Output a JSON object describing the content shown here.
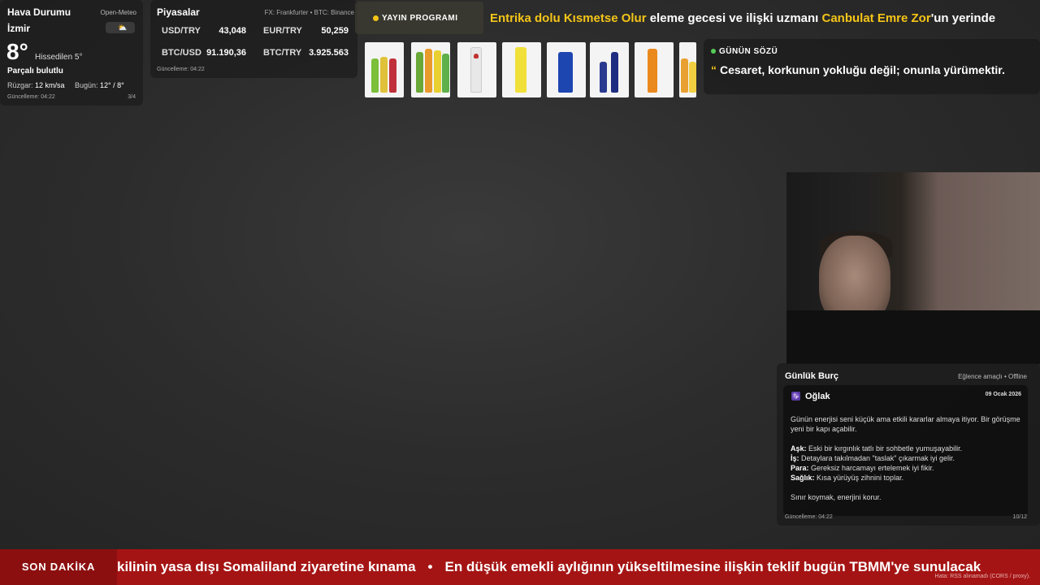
{
  "weather": {
    "title": "Hava Durumu",
    "source": "Open-Meteo",
    "city": "İzmir",
    "icon": "cloud-sun-icon",
    "temperature": "8°",
    "feels_like": "Hissedilen 5°",
    "condition": "Parçalı bulutlu",
    "wind_label": "Rüzgar:",
    "wind_value": "12 km/sa",
    "today_label": "Bugün:",
    "today_value": "12° / 8°",
    "updated": "Güncelleme: 04:22",
    "page": "3/4"
  },
  "markets": {
    "title": "Piyasalar",
    "source": "FX: Frankfurter • BTC: Binance",
    "rows": [
      {
        "label": "USD/TRY",
        "value": "43,048"
      },
      {
        "label": "EUR/TRY",
        "value": "50,259"
      },
      {
        "label": "BTC/USD",
        "value": "91.190,36"
      },
      {
        "label": "BTC/TRY",
        "value": "3.925.563"
      }
    ],
    "updated": "Güncelleme: 04:22"
  },
  "program": {
    "label": "YAYIN PROGRAMI",
    "parts": [
      {
        "text": "Entrika dolu Kısmetse Olur",
        "highlight": true
      },
      {
        "text": " eleme gecesi ve ilişki uzmanı ",
        "highlight": false
      },
      {
        "text": "Canbulat Emre Zor",
        "highlight": true
      },
      {
        "text": "'un yerinde",
        "highlight": false
      }
    ]
  },
  "products": {
    "items": [
      "product-bottle-1",
      "product-bottle-2",
      "product-bottle-3",
      "product-bottle-4",
      "product-bottle-5",
      "product-bottle-6",
      "product-bottle-7",
      "product-bottle-8"
    ]
  },
  "quote": {
    "label": "GÜNÜN SÖZÜ",
    "open_mark": "“",
    "text": "Cesaret, korkunun yokluğu değil; onunla yürümektir."
  },
  "horoscope": {
    "title": "Günlük Burç",
    "mode": "Eğlence amaçlı • Offline",
    "sign_icon": "♑",
    "sign": "Oğlak",
    "date": "09 Ocak 2026",
    "summary": "Günün enerjisi seni küçük ama etkili kararlar almaya itiyor. Bir görüşme yeni bir kapı açabilir.",
    "details": [
      {
        "label": "Aşk:",
        "text": " Eski bir kırgınlık tatlı bir sohbetle yumuşayabilir."
      },
      {
        "label": "İş:",
        "text": " Detaylara takılmadan \"taslak\" çıkarmak iyi gelir."
      },
      {
        "label": "Para:",
        "text": " Gereksiz harcamayı ertelemek iyi fikir."
      },
      {
        "label": "Sağlık:",
        "text": " Kısa yürüyüş zihnini toplar."
      }
    ],
    "closing": "Sınır koymak, enerjini korur.",
    "updated": "Güncelleme: 04:22",
    "page": "10/12"
  },
  "breaking": {
    "label": "SON DAKİKA",
    "items": [
      "kilinin yasa dışı Somaliland ziyaretine kınama",
      "En düşük emekli aylığının yükseltilmesine ilişkin teklif bugün TBMM'ye sunulacak"
    ],
    "separator": "•",
    "error": "Hata: RSS alınamadı (CORS / proxy)."
  },
  "colors": {
    "accent": "#f5c518",
    "breaking_bg": "#a51414",
    "quote_dot": "#55cc55"
  }
}
